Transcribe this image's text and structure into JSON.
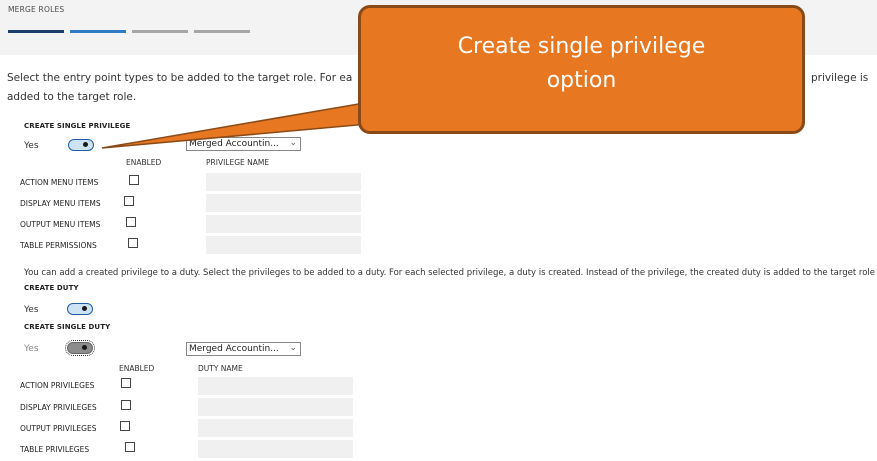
{
  "page": {
    "title": "MERGE ROLES",
    "steps": [
      {
        "state": "complete",
        "color": "#1d3d6b"
      },
      {
        "state": "current",
        "color": "#2e7bc4"
      },
      {
        "state": "pending",
        "color": "#a6a6a6"
      },
      {
        "state": "pending",
        "color": "#a6a6a6"
      }
    ]
  },
  "intro": {
    "line1_start": "Select the entry point types to be added to the target role. For ea",
    "line1_end": "privilege is",
    "line2": "added to the target role."
  },
  "single_privilege": {
    "heading": "CREATE SINGLE PRIVILEGE",
    "toggle_label": "Yes",
    "toggle_on": true,
    "select_value": "Merged Accountin...",
    "col_enabled": "ENABLED",
    "col_name": "PRIVILEGE NAME",
    "rows": [
      {
        "label": "ACTION MENU ITEMS",
        "checked": false,
        "value": ""
      },
      {
        "label": "DISPLAY MENU ITEMS",
        "checked": false,
        "value": ""
      },
      {
        "label": "OUTPUT MENU ITEMS",
        "checked": false,
        "value": ""
      },
      {
        "label": "TABLE PERMISSIONS",
        "checked": false,
        "value": ""
      }
    ]
  },
  "duty_info": "You can add a created privilege to a duty. Select the privileges to be added to a duty. For each selected privilege, a duty is created. Instead of the privilege, the created duty is added to the target role",
  "create_duty": {
    "heading": "CREATE DUTY",
    "toggle_label": "Yes",
    "toggle_on": true
  },
  "single_duty": {
    "heading": "CREATE SINGLE DUTY",
    "toggle_label": "Yes",
    "toggle_on": true,
    "select_value": "Merged Accountin...",
    "col_enabled": "ENABLED",
    "col_name": "DUTY NAME",
    "rows": [
      {
        "label": "ACTION PRIVILEGES",
        "checked": false,
        "value": ""
      },
      {
        "label": "DISPLAY PRIVILEGES",
        "checked": false,
        "value": ""
      },
      {
        "label": "OUTPUT PRIVILEGES",
        "checked": false,
        "value": ""
      },
      {
        "label": "TABLE PRIVILEGES",
        "checked": false,
        "value": ""
      }
    ]
  },
  "callout": {
    "line1": "Create single privilege",
    "line2": "option",
    "fill": "#e87722",
    "border": "#8a4a18"
  },
  "icons": {
    "dropdown": "chevron-down-icon"
  }
}
